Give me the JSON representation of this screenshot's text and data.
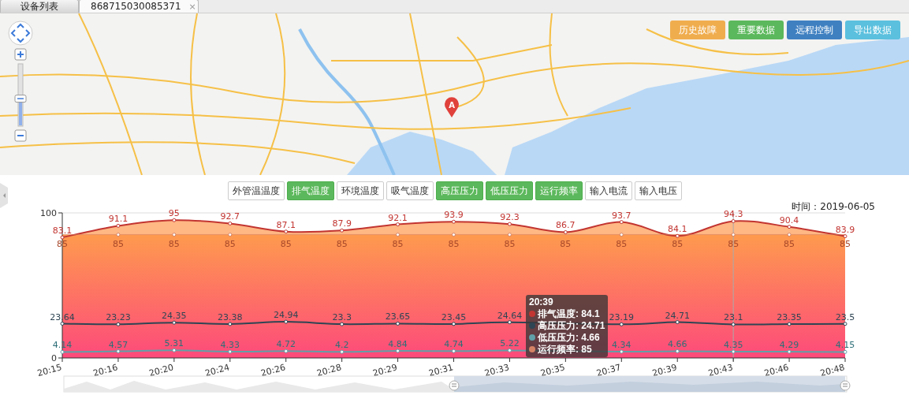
{
  "tabs": [
    {
      "label": "设备列表",
      "selected": false,
      "closable": false
    },
    {
      "label": "868715030085371",
      "selected": true,
      "closable": true,
      "close_glyph": "×"
    }
  ],
  "map": {
    "marker_label": "A",
    "zoom": {
      "level": 0.45
    }
  },
  "actions": [
    {
      "label": "历史故障",
      "color": "#f0ad4e"
    },
    {
      "label": "重要数据",
      "color": "#5cb85c"
    },
    {
      "label": "远程控制",
      "color": "#3f80c1"
    },
    {
      "label": "导出数据",
      "color": "#5bc0de"
    }
  ],
  "series_toggles": [
    {
      "label": "外管温温度",
      "selected": false
    },
    {
      "label": "排气温度",
      "selected": true
    },
    {
      "label": "环境温度",
      "selected": false
    },
    {
      "label": "吸气温度",
      "selected": false
    },
    {
      "label": "高压压力",
      "selected": true
    },
    {
      "label": "低压压力",
      "selected": true
    },
    {
      "label": "运行频率",
      "selected": true
    },
    {
      "label": "输入电流",
      "selected": false
    },
    {
      "label": "输入电压",
      "selected": false
    }
  ],
  "date_label": "时间：2019-06-05",
  "chart": {
    "chart_data": {
      "type": "line",
      "categories": [
        "20:15",
        "20:16",
        "20:20",
        "20:24",
        "20:26",
        "20:28",
        "20:29",
        "20:31",
        "20:33",
        "20:35",
        "20:37",
        "20:39",
        "20:43",
        "20:46",
        "20:48"
      ],
      "series": [
        {
          "name": "排气温度",
          "color": "#c23531",
          "marker": "circle",
          "values": [
            83.1,
            91.1,
            95,
            92.7,
            87.1,
            87.9,
            92.1,
            93.9,
            92.3,
            86.7,
            93.7,
            84.1,
            94.3,
            90.4,
            83.9
          ]
        },
        {
          "name": "高压压力",
          "color": "#2f4554",
          "marker": "circle",
          "values": [
            23.64,
            23.23,
            24.35,
            23.38,
            24.94,
            23.3,
            23.65,
            23.45,
            24.64,
            null,
            23.19,
            24.71,
            23.1,
            23.35,
            23.5
          ]
        },
        {
          "name": "低压压力",
          "color": "#61a0a8",
          "marker": "circle",
          "values": [
            4.14,
            4.57,
            5.31,
            4.33,
            4.72,
            4.2,
            4.84,
            4.74,
            5.22,
            null,
            4.34,
            4.66,
            4.35,
            4.29,
            4.15
          ]
        },
        {
          "name": "运行频率",
          "color": "#d48265",
          "marker": "circle",
          "values": [
            85,
            85,
            85,
            85,
            85,
            85,
            85,
            85,
            85,
            85,
            85,
            85,
            85,
            85,
            85
          ]
        }
      ],
      "ylim": [
        0,
        100
      ],
      "yticks": [
        0,
        100
      ],
      "data_labels": true
    },
    "tooltip": {
      "title": "20:39",
      "separator": ": ",
      "items": [
        {
          "value": "84.1"
        },
        {
          "value": "24.71"
        },
        {
          "value": "4.66"
        },
        {
          "value": "85"
        }
      ]
    }
  }
}
